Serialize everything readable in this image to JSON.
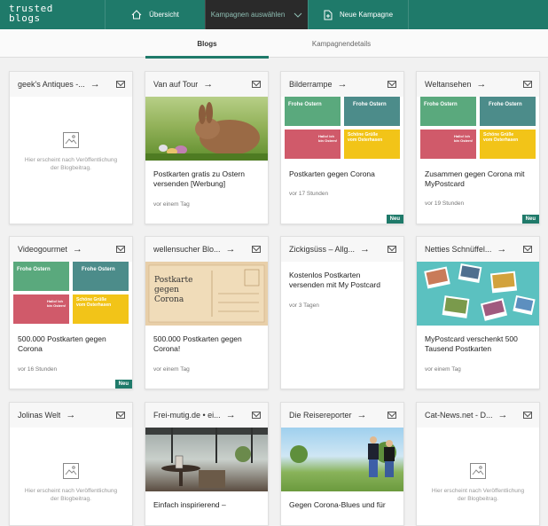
{
  "brand": {
    "logo_line1": "trusted",
    "logo_line2": "blogs",
    "accent": "#1f7a6a"
  },
  "nav": {
    "overview": "Übersicht",
    "select_campaign": "Kampagnen auswählen",
    "new_campaign": "Neue Kampagne"
  },
  "tabs": {
    "blogs": "Blogs",
    "details": "Kampagnendetails"
  },
  "placeholder_text": "Hier erscheint nach Veröffentlichung der Blogbeitrag.",
  "badge_label": "Neu",
  "cards": [
    {
      "title": "geek's Antiques -...",
      "text": "",
      "time": ""
    },
    {
      "title": "Van auf Tour",
      "text": "Postkarten gratis zu Ostern versenden [Werbung]",
      "time": "vor einem Tag"
    },
    {
      "title": "Bilderrampe",
      "text": "Postkarten gegen Corona",
      "time": "vor 17 Stunden"
    },
    {
      "title": "Weltansehen",
      "text": "Zusammen gegen Corona mit MyPostcard",
      "time": "vor 19 Stunden"
    },
    {
      "title": "Videogourmet",
      "text": "500.000 Postkarten gegen Corona",
      "time": "vor 16 Stunden"
    },
    {
      "title": "wellensucher Blo...",
      "text": "500.000 Postkarten gegen Corona!",
      "time": "vor einem Tag"
    },
    {
      "title": "Zickigsüss – Allg...",
      "text": "Kostenlos Postkarten versenden mit My Postcard",
      "time": "vor 3 Tagen"
    },
    {
      "title": "Netties Schnüffel...",
      "text": "MyPostcard verschenkt 500 Tausend Postkarten",
      "time": "vor einem Tag"
    },
    {
      "title": "Jolinas Welt",
      "text": "",
      "time": ""
    },
    {
      "title": "Frei-mutig.de • ei...",
      "text": "Einfach inspirierend –",
      "time": ""
    },
    {
      "title": "Die Reisereporter",
      "text": "Gegen Corona-Blues und für",
      "time": ""
    },
    {
      "title": "Cat-News.net - D...",
      "text": "",
      "time": ""
    }
  ],
  "tiles": {
    "frohe_ostern": "Frohe Ostern",
    "schoene_gruesse": "Schöne Grüße vom Osterhasen",
    "halloe": "Hallo! Ich bin Ostern!",
    "postkarte_gegen_corona": "Postkarte gegen Corona"
  }
}
